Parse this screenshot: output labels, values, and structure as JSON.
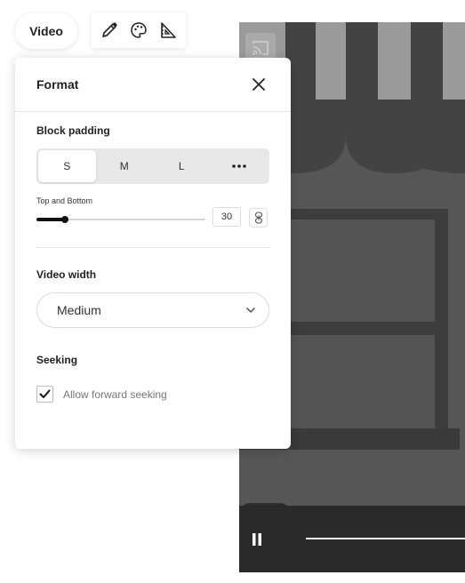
{
  "header": {
    "video_chip_label": "Video",
    "tools": [
      {
        "icon": "pencil-icon"
      },
      {
        "icon": "palette-icon"
      },
      {
        "icon": "ruler-triangle-icon"
      }
    ]
  },
  "panel": {
    "title": "Format",
    "block_padding": {
      "label": "Block padding",
      "options": [
        "S",
        "M",
        "L",
        "..."
      ],
      "selected": "S"
    },
    "top_bottom": {
      "label": "Top and Bottom",
      "value": "30",
      "slider_fraction": 0.17
    },
    "video_width": {
      "label": "Video width",
      "selected": "Medium"
    },
    "seeking": {
      "label": "Seeking",
      "checkbox_label": "Allow forward seeking",
      "checked": true
    }
  },
  "video": {
    "icons": [
      "cast-icon",
      "pause-icon"
    ]
  },
  "colors": {
    "accent": "#111111",
    "video_bg": "#565656",
    "controls_bg": "#2a2a2a"
  }
}
